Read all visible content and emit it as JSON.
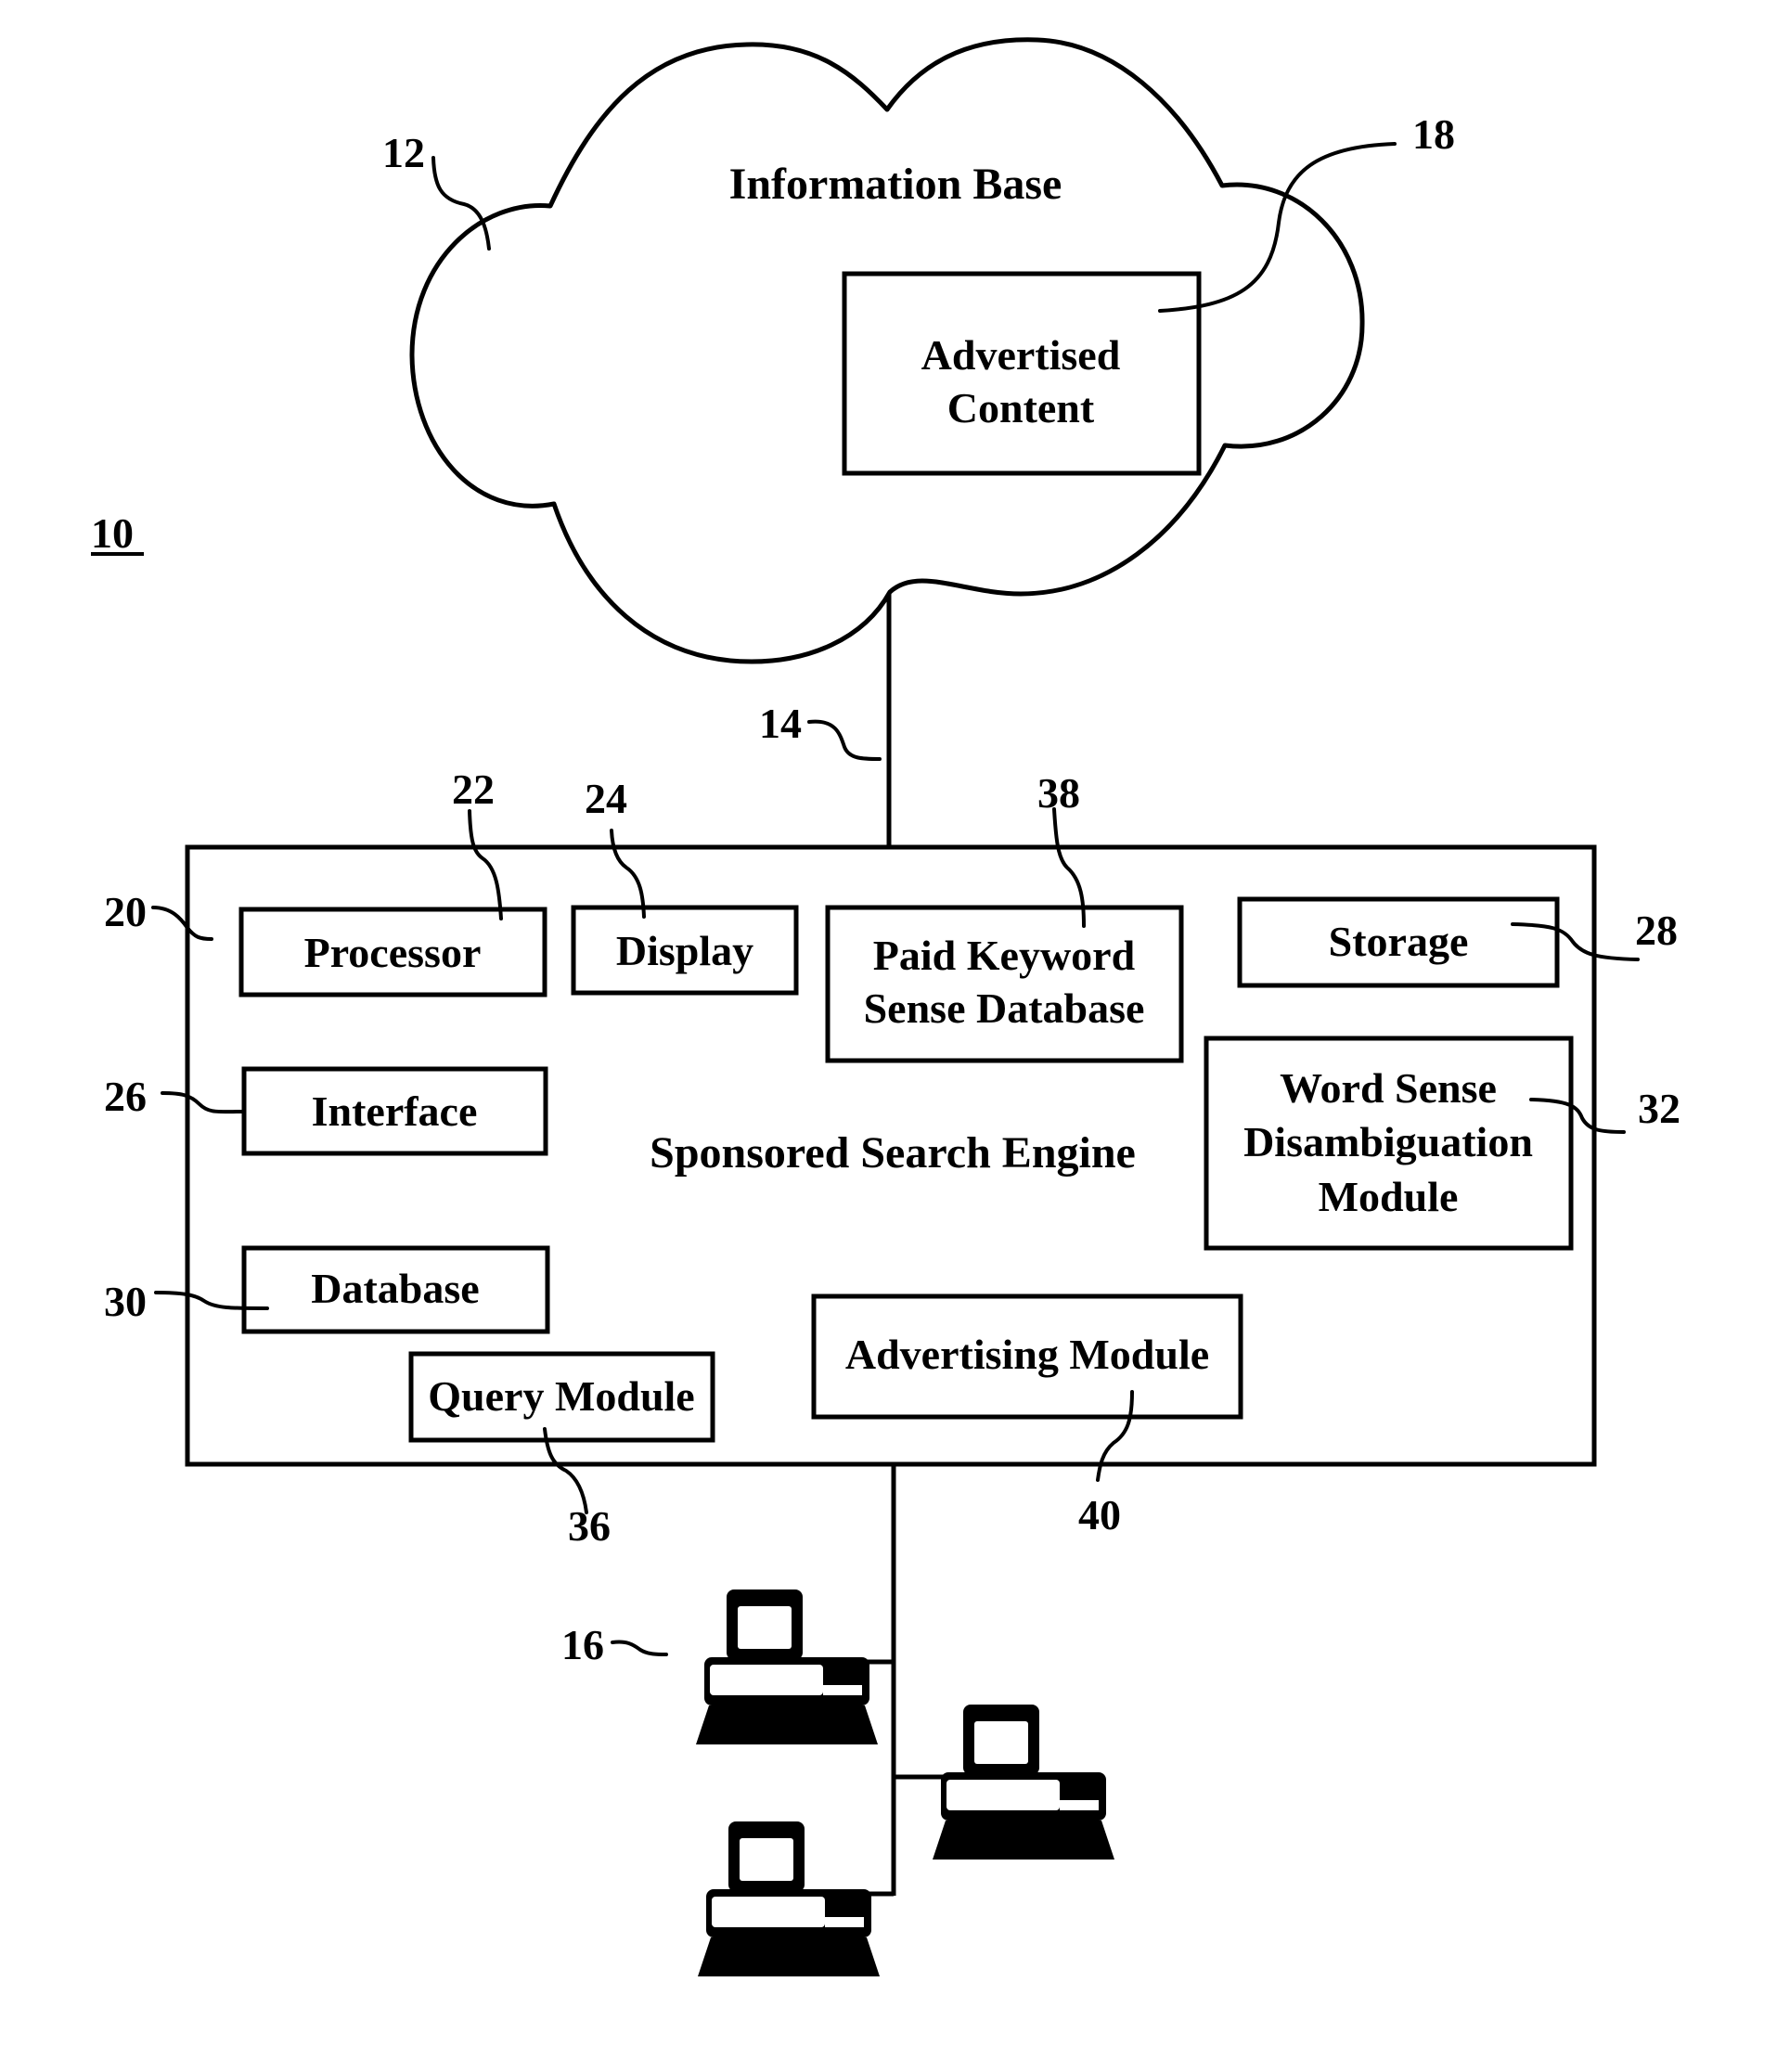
{
  "figure": {
    "figure_ref": "10",
    "information_base": {
      "label": "Information Base",
      "ref": "12",
      "advertised_content": {
        "lines": [
          "Advertised",
          "Content"
        ],
        "ref": "18"
      }
    },
    "network_link": {
      "ref": "14"
    },
    "engine": {
      "label": "Sponsored Search Engine",
      "ref": "20",
      "components": {
        "processor": {
          "label": "Processor",
          "ref": "22"
        },
        "display": {
          "label": "Display",
          "ref": "24"
        },
        "interface": {
          "label": "Interface",
          "ref": "26"
        },
        "storage": {
          "label": "Storage",
          "ref": "28"
        },
        "database": {
          "label": "Database",
          "ref": "30"
        },
        "wsd_module": {
          "lines": [
            "Word Sense",
            "Disambiguation",
            "Module"
          ],
          "ref": "32"
        },
        "query_module": {
          "label": "Query Module",
          "ref": "36"
        },
        "paid_keyword_db": {
          "lines": [
            "Paid Keyword",
            "Sense Database"
          ],
          "ref": "38"
        },
        "advertising_module": {
          "label": "Advertising Module",
          "ref": "40"
        }
      }
    },
    "clients": {
      "ref": "16",
      "count": 3,
      "icon": "desktop-computer-icon"
    }
  }
}
